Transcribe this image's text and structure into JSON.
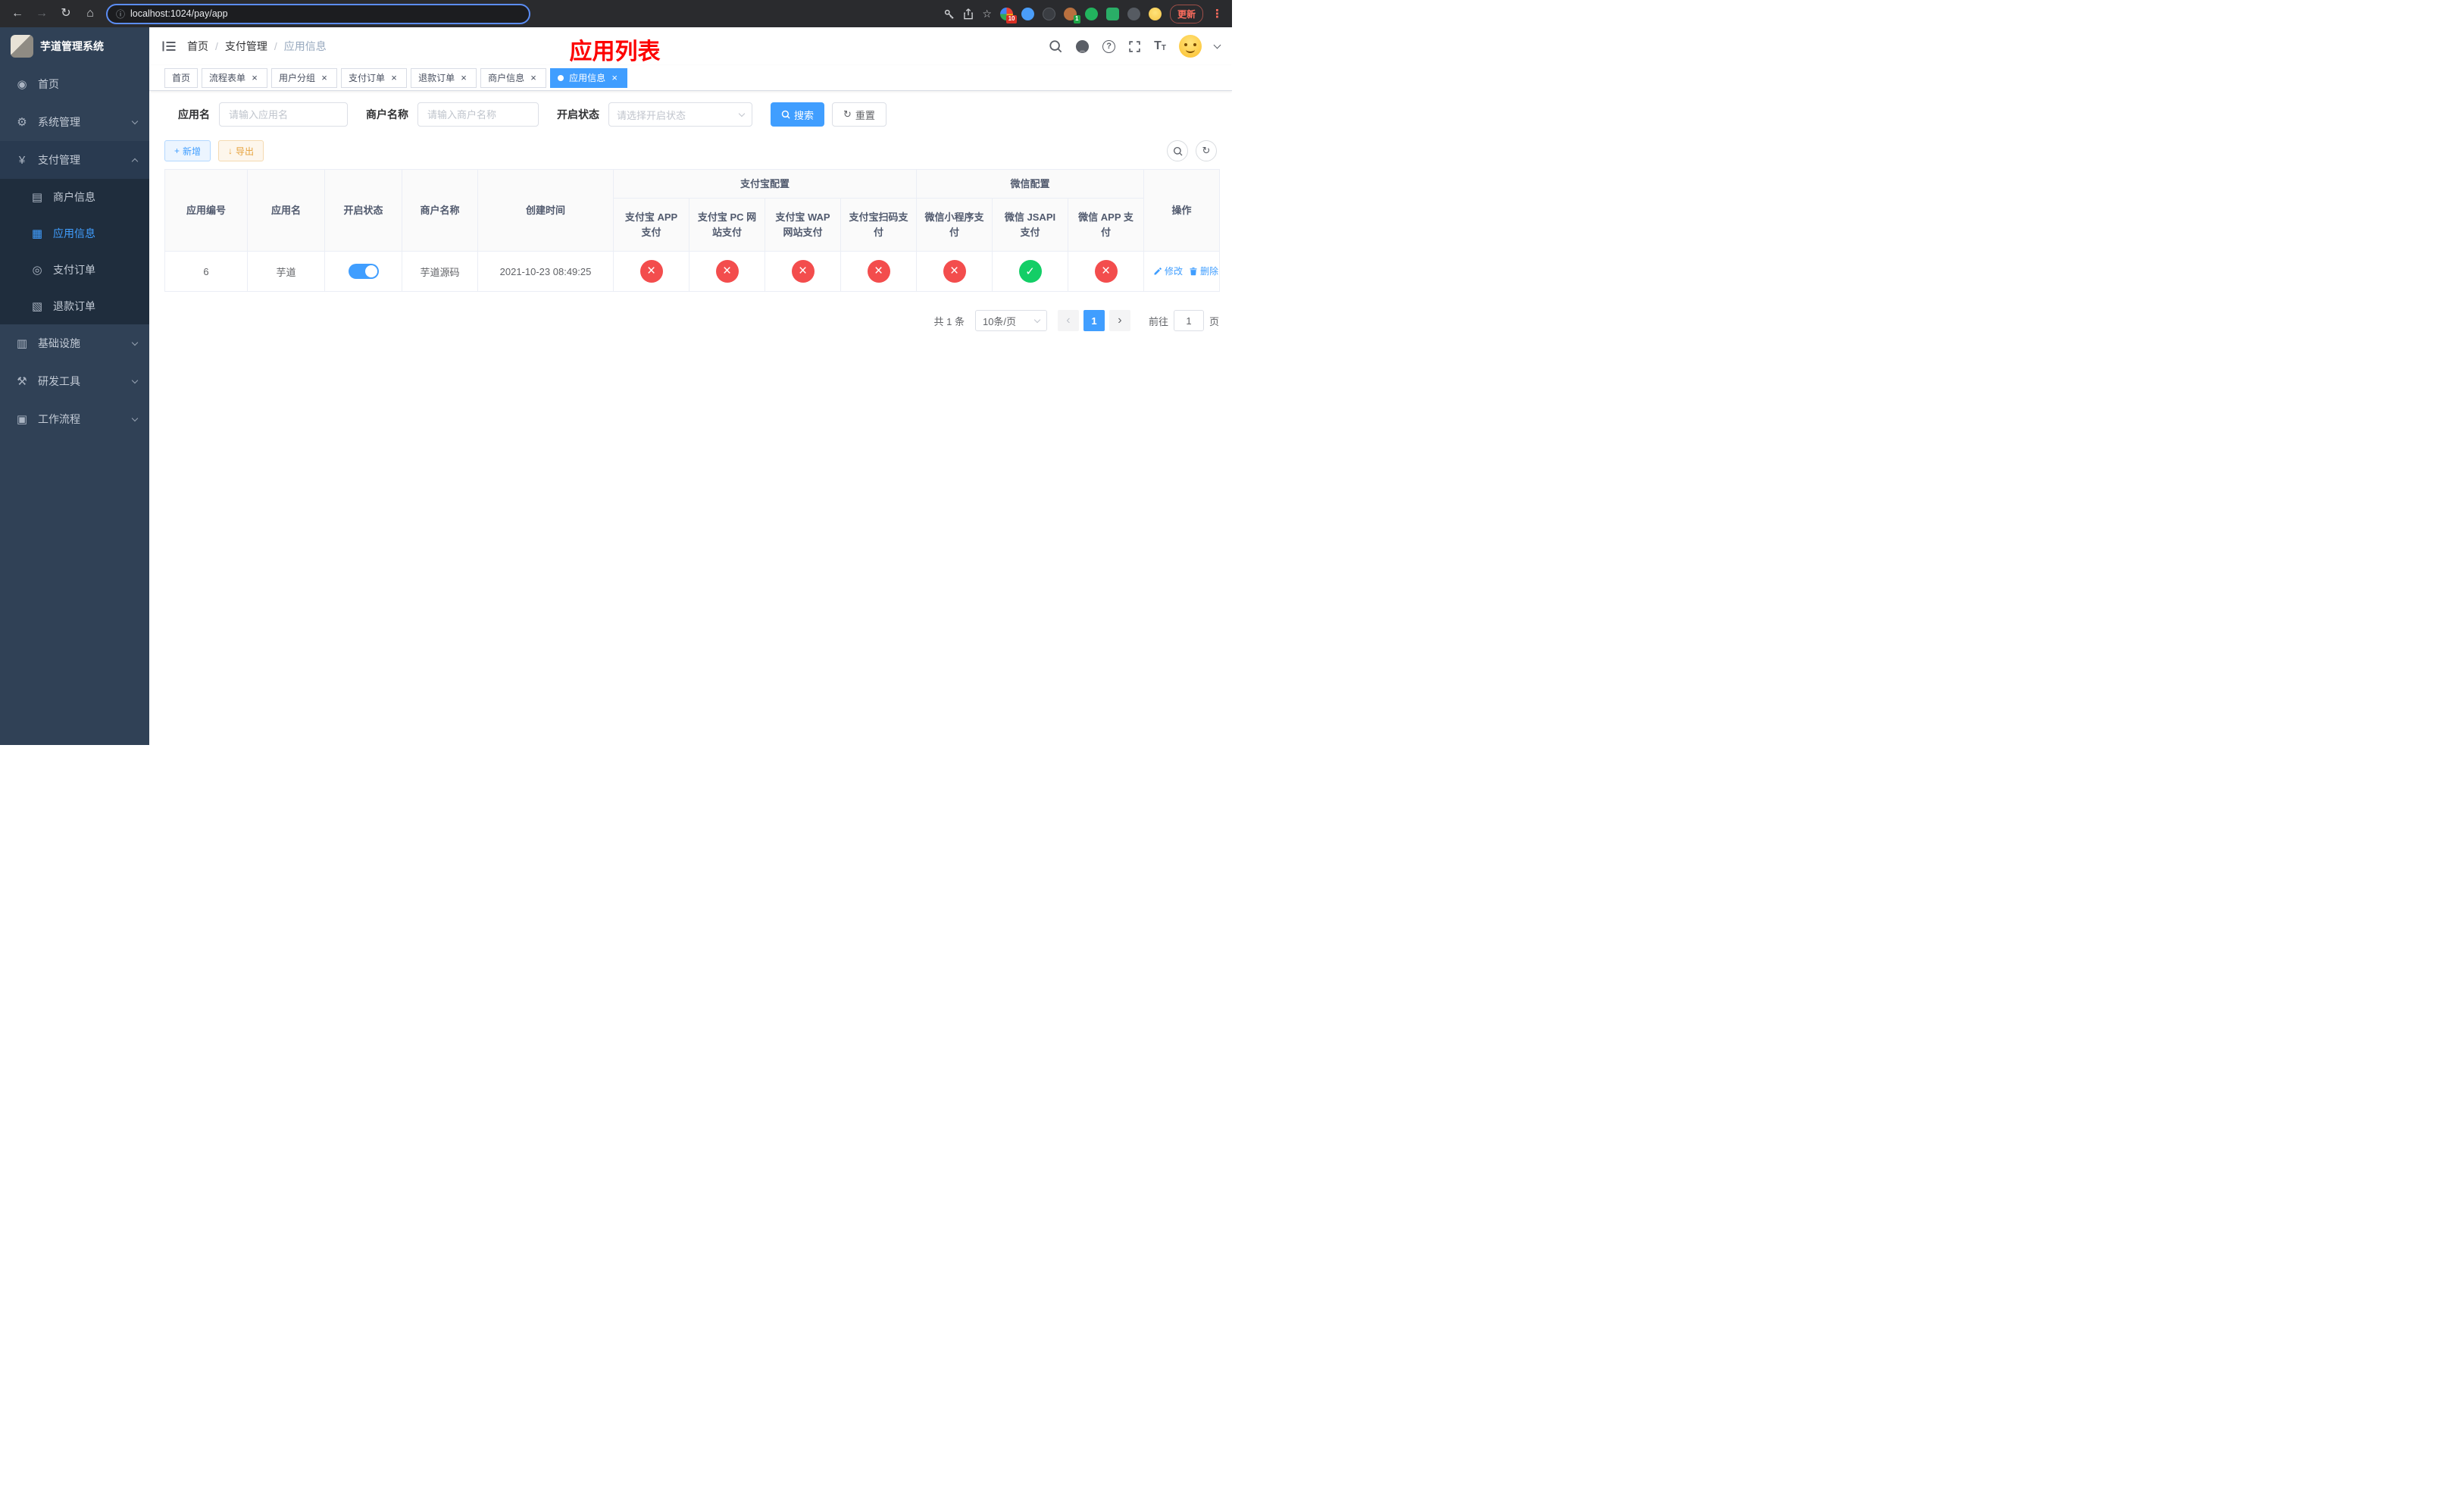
{
  "colors": {
    "primary": "#409eff",
    "danger": "#f34d4d",
    "success": "#13ce66",
    "warning": "#e6a23c",
    "title_red": "#fd0100",
    "sidebar_bg": "#304156",
    "submenu_bg": "#1f2d3d"
  },
  "icons": {
    "back": "←",
    "forward": "→",
    "reload": "↻",
    "home": "⌂",
    "info": "ⓘ",
    "star": "☆",
    "overflow_menu": "⋮",
    "dashboard": "◉",
    "gear": "⚙",
    "yen": "¥",
    "merchant": "▤",
    "app_grid": "▦",
    "order": "◎",
    "refund": "▧",
    "infra": "▥",
    "devtools": "⚒",
    "workflow": "▣",
    "close": "×",
    "question": "?",
    "letter_t": "T",
    "plus": "+",
    "download": "↓",
    "refresh": "↻",
    "prev": "‹",
    "next": "›"
  },
  "browser": {
    "url": "localhost:1024/pay/app",
    "update_label": "更新",
    "extension_badge_count": "10",
    "profile_badge_count": "1"
  },
  "sidebar": {
    "app_title": "芋道管理系统",
    "items": {
      "home": "首页",
      "system": "系统管理",
      "payment": "支付管理",
      "infra": "基础设施",
      "devtools": "研发工具",
      "workflow": "工作流程"
    },
    "children": {
      "merchant": "商户信息",
      "app": "应用信息",
      "order": "支付订单",
      "refund": "退款订单"
    }
  },
  "header": {
    "breadcrumb_home": "首页",
    "breadcrumb_section": "支付管理",
    "breadcrumb_current": "应用信息",
    "breadcrumb_separator": "/",
    "page_title": "应用列表"
  },
  "tabs": {
    "home": "首页",
    "flow_form": "流程表单",
    "user_group": "用户分组",
    "pay_order": "支付订单",
    "refund_order": "退款订单",
    "merchant_info": "商户信息",
    "app_info": "应用信息"
  },
  "filters": {
    "app_name_label": "应用名",
    "app_name_placeholder": "请输入应用名",
    "merchant_label": "商户名称",
    "merchant_placeholder": "请输入商户名称",
    "status_label": "开启状态",
    "status_placeholder": "请选择开启状态",
    "search_label": "搜索",
    "reset_label": "重置"
  },
  "toolbar": {
    "add_label": "新增",
    "export_label": "导出"
  },
  "table": {
    "headers": {
      "app_id": "应用编号",
      "app_name": "应用名",
      "status": "开启状态",
      "merchant_name": "商户名称",
      "created_at": "创建时间",
      "alipay_group": "支付宝配置",
      "wechat_group": "微信配置",
      "alipay_app": "支付宝 APP 支付",
      "alipay_pc": "支付宝 PC 网站支付",
      "alipay_wap": "支付宝 WAP 网站支付",
      "alipay_qr": "支付宝扫码支付",
      "wechat_lite": "微信小程序支付",
      "wechat_jsapi": "微信 JSAPI 支付",
      "wechat_app": "微信 APP 支付",
      "actions": "操作"
    },
    "row": {
      "app_id": "6",
      "app_name": "芋道",
      "status_on": "true",
      "merchant_name": "芋道源码",
      "created_at": "2021-10-23 08:49:25",
      "alipay_app": "no",
      "alipay_pc": "no",
      "alipay_wap": "no",
      "alipay_qr": "no",
      "wechat_lite": "no",
      "wechat_jsapi": "yes",
      "wechat_app": "no",
      "edit_label": "修改",
      "delete_label": "删除"
    }
  },
  "pagination": {
    "total_text": "共 1 条",
    "page_size": "10条/页",
    "current_page": "1",
    "goto_prefix": "前往",
    "goto_value": "1",
    "goto_suffix": "页"
  }
}
